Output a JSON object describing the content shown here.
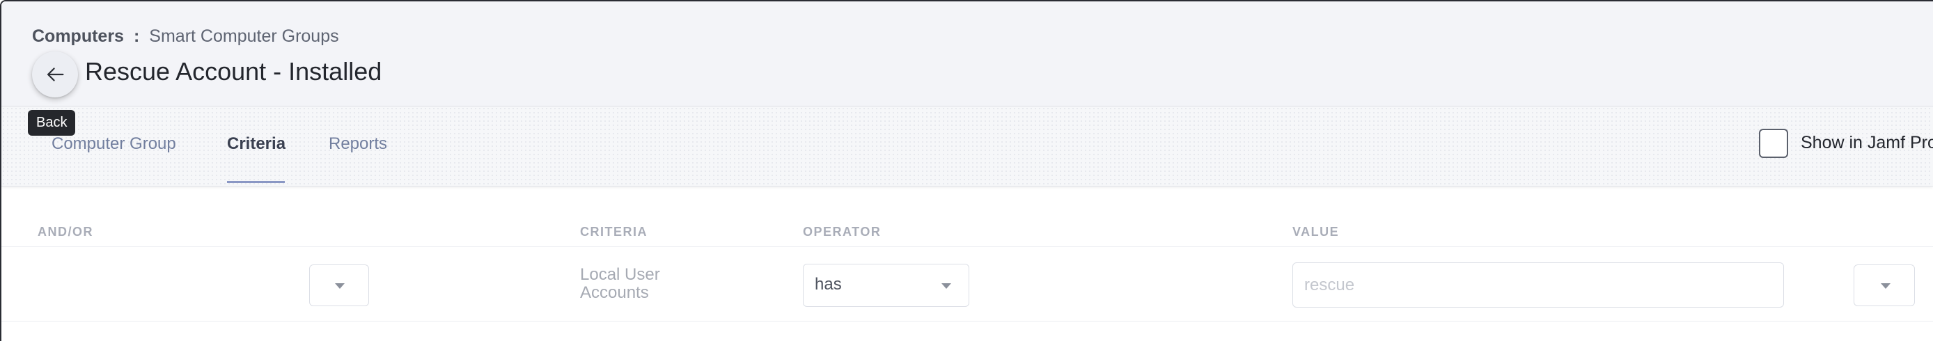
{
  "header": {
    "breadcrumb_root": "Computers",
    "breadcrumb_separator": ":",
    "breadcrumb_current": "Smart Computer Groups",
    "title": "Rescue Account - Installed",
    "back_tooltip": "Back"
  },
  "tabs": [
    {
      "label": "Computer Group",
      "active": false
    },
    {
      "label": "Criteria",
      "active": true
    },
    {
      "label": "Reports",
      "active": false
    }
  ],
  "show_in_jamf": {
    "label": "Show in Jamf Pro",
    "checked": false
  },
  "criteria_table": {
    "headers": [
      "AND/OR",
      "CRITERIA",
      "OPERATOR",
      "VALUE"
    ],
    "rows": [
      {
        "and_or": "",
        "criteria": "Local User Accounts",
        "operator": "has",
        "value": "rescue"
      }
    ]
  },
  "icons": {
    "back": "arrow-left-icon",
    "dropdown": "caret-down-icon"
  },
  "colors": {
    "header_bg": "#f3f4f8",
    "active_tab_underline": "#8a97c4",
    "tooltip_bg": "#25272c"
  }
}
